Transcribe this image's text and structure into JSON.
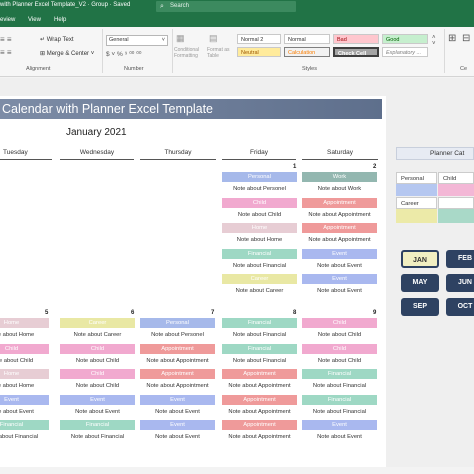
{
  "window": {
    "title": "with Planner Excel Template_V2 · Group · Saved",
    "search_placeholder": "Search"
  },
  "menu": {
    "tabs": [
      "eview",
      "View",
      "Help"
    ]
  },
  "ribbon": {
    "wrap_text": "Wrap Text",
    "merge_center": "Merge & Center",
    "alignment_group": "Alignment",
    "number_format": "General",
    "number_group": "Number",
    "conditional_formatting": "Conditional Formatting",
    "format_as_table": "Format as Table",
    "styles_group": "Styles",
    "styles": {
      "normal2": "Normal 2",
      "normal": "Normal",
      "bad": "Bad",
      "good": "Good",
      "neutral": "Neutral",
      "calculation": "Calculation",
      "check_cell": "Check Cell",
      "explanatory": "Explanatory ..."
    },
    "cells_group": "Ce"
  },
  "calendar": {
    "title": "Calendar with Planner Excel Template",
    "month": "January 2021",
    "days": [
      "Tuesday",
      "Wednesday",
      "Thursday",
      "Friday",
      "Saturday"
    ]
  },
  "week1": {
    "friday": {
      "num": "1",
      "entries": [
        [
          "Personal",
          "Note about Personel"
        ],
        [
          "Child",
          "Note about Child"
        ],
        [
          "Home",
          "Note about Home"
        ],
        [
          "Financial",
          "Note about Financial"
        ],
        [
          "Career",
          "Note about Career"
        ]
      ]
    },
    "saturday": {
      "num": "2",
      "entries": [
        [
          "Work",
          "Note about Work"
        ],
        [
          "Appointment",
          "Note about Appointment"
        ],
        [
          "Appointment",
          "Note about Appointment"
        ],
        [
          "Event",
          "Note about Event"
        ],
        [
          "Event",
          "Note about Event"
        ]
      ]
    }
  },
  "week2": [
    {
      "num": "5",
      "entries": [
        [
          "Home",
          "Note about Home"
        ],
        [
          "Child",
          "Note about Child"
        ],
        [
          "Home",
          "Note about Home"
        ],
        [
          "Event",
          "Note about Event"
        ],
        [
          "Financial",
          "Note about Financial"
        ]
      ]
    },
    {
      "num": "6",
      "entries": [
        [
          "Career",
          "Note about Career"
        ],
        [
          "Child",
          "Note about Child"
        ],
        [
          "Child",
          "Note about Child"
        ],
        [
          "Event",
          "Note about Event"
        ],
        [
          "Financial",
          "Note about Financial"
        ]
      ]
    },
    {
      "num": "7",
      "entries": [
        [
          "Personal",
          "Note about Personel"
        ],
        [
          "Appointment",
          "Note about Appointment"
        ],
        [
          "Appointment",
          "Note about Appointment"
        ],
        [
          "Event",
          "Note about Event"
        ],
        [
          "Event",
          "Note about Event"
        ]
      ]
    },
    {
      "num": "8",
      "entries": [
        [
          "Financial",
          "Note about Financial"
        ],
        [
          "Financial",
          "Note about Financial"
        ],
        [
          "Appointment",
          "Note about Appointment"
        ],
        [
          "Appointment",
          "Note about Appointment"
        ],
        [
          "Appointment",
          "Note about Appointment"
        ]
      ]
    },
    {
      "num": "9",
      "entries": [
        [
          "Child",
          "Note about Child"
        ],
        [
          "Child",
          "Note about Child"
        ],
        [
          "Financial",
          "Note about Financial"
        ],
        [
          "Financial",
          "Note about Financial"
        ],
        [
          "Event",
          "Note about Event"
        ]
      ]
    }
  ],
  "panel": {
    "header": "Planner Cat",
    "categories": [
      "Personal",
      "Child",
      "Career",
      ""
    ]
  },
  "months": [
    "JAN",
    "FEB",
    "MAY",
    "JUN",
    "SEP",
    "OCT"
  ],
  "colors": {
    "Personal": "#a6b9ea",
    "Child": "#f1a9cf",
    "Home": "#e7cdd4",
    "Financial": "#9ed8c4",
    "Career": "#e9e8a4",
    "Work": "#93b7b0",
    "Appointment": "#ef9a9a",
    "Event": "#a9b8ef",
    "accent": "#217346",
    "banner": "#6b7b98",
    "month_button": "#2e4262"
  }
}
